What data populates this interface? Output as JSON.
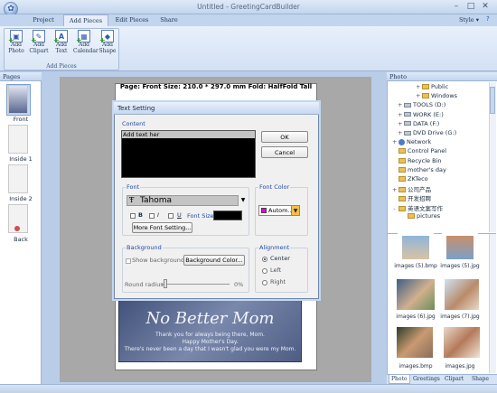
{
  "window": {
    "title": "Untitled - GreetingCardBuilder",
    "style_label": "Style"
  },
  "ribbon": {
    "tabs": [
      "Project",
      "Add Pieces",
      "Edit Pieces",
      "Share"
    ],
    "active_tab": "Add Pieces",
    "group_label": "Add Pieces",
    "buttons": [
      {
        "label1": "Add",
        "label2": "Photo",
        "icon": "add-photo-icon"
      },
      {
        "label1": "Add",
        "label2": "Clipart",
        "icon": "add-clipart-icon"
      },
      {
        "label1": "Add",
        "label2": "Text",
        "icon": "add-text-icon"
      },
      {
        "label1": "Add",
        "label2": "Calendar",
        "icon": "add-calendar-icon"
      },
      {
        "label1": "Add",
        "label2": "Shape",
        "icon": "add-shape-icon"
      }
    ]
  },
  "pages_panel": {
    "title": "Pages",
    "pages": [
      {
        "label": "Front"
      },
      {
        "label": "Inside 1"
      },
      {
        "label": "Inside 2"
      },
      {
        "label": "Back"
      }
    ]
  },
  "canvas": {
    "page_info": "Page: Front  Size: 210.0 * 297.0 mm   Fold: HalfFold Tall",
    "card_title": "No Better Mom",
    "card_lines": [
      "Thank you for always being there, Mom.",
      "Happy Mother's Day.",
      "There's never been a day that I wasn't glad you were my Mom."
    ]
  },
  "dialog": {
    "title": "Text Setting",
    "content_label": "Content",
    "content_text": "Add text her",
    "ok": "OK",
    "cancel": "Cancel",
    "font_label": "Font",
    "font_name": "Tahoma",
    "bold": "B",
    "italic": "I",
    "underline": "U",
    "font_size_label": "Font Size",
    "more_font": "More Font Setting...",
    "font_color_label": "Font Color",
    "font_color_value": "Autom...",
    "font_color_swatch": "#e600e6",
    "background_label": "Background",
    "show_background": "Show background",
    "background_color_btn": "Background Color...",
    "round_radius_label": "Round radius:",
    "round_radius_value": "0%",
    "alignment_label": "Alignment",
    "align_options": [
      "Center",
      "Left",
      "Right"
    ],
    "align_selected": "Center"
  },
  "photo_panel": {
    "title": "Photo",
    "tree": [
      {
        "label": "Public",
        "kind": "folder",
        "toggle": "+"
      },
      {
        "label": "Windows",
        "kind": "folder",
        "toggle": "+"
      },
      {
        "label": "TOOLS (D:)",
        "kind": "drive",
        "toggle": "+"
      },
      {
        "label": "WORK (E:)",
        "kind": "drive",
        "toggle": "+"
      },
      {
        "label": "DATA (F:)",
        "kind": "drive",
        "toggle": "+"
      },
      {
        "label": "DVD Drive (G:)",
        "kind": "drive",
        "toggle": "+"
      },
      {
        "label": "Network",
        "kind": "network",
        "toggle": "+"
      },
      {
        "label": "Control Panel",
        "kind": "folder",
        "toggle": ""
      },
      {
        "label": "Recycle Bin",
        "kind": "folder",
        "toggle": ""
      },
      {
        "label": "mother's day",
        "kind": "folder",
        "toggle": ""
      },
      {
        "label": "ZKTeco",
        "kind": "folder",
        "toggle": ""
      },
      {
        "label": "公司产品",
        "kind": "folder",
        "toggle": "+"
      },
      {
        "label": "开发招聘",
        "kind": "folder",
        "toggle": ""
      },
      {
        "label": "英语文案写作",
        "kind": "folder",
        "toggle": "-"
      },
      {
        "label": "pictures",
        "kind": "folder",
        "toggle": ""
      }
    ],
    "thumbs": [
      {
        "label": "images (5).bmp"
      },
      {
        "label": "images (5).jpg"
      },
      {
        "label": "images (6).jpg"
      },
      {
        "label": "images (7).jpg"
      },
      {
        "label": "images.bmp"
      },
      {
        "label": "images.jpg"
      }
    ],
    "bottom_tabs": [
      "Photo",
      "Greetings",
      "Clipart",
      "Shape"
    ],
    "active_bottom_tab": "Photo"
  }
}
